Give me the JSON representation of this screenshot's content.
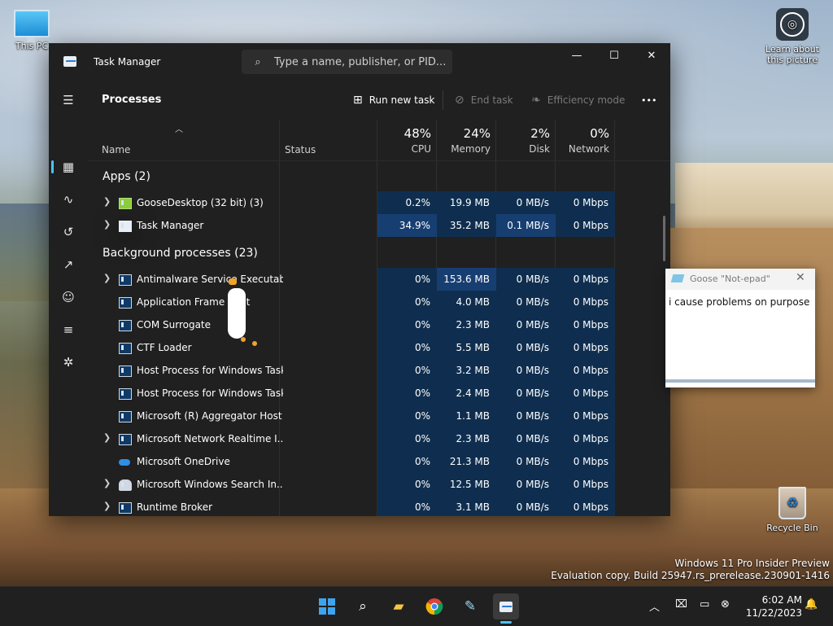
{
  "desktop": {
    "this_pc": "This PC",
    "learn_line1": "Learn about",
    "learn_line2": "this picture",
    "recycle_bin": "Recycle Bin",
    "watermark_line1": "Windows 11 Pro Insider Preview",
    "watermark_line2": "Evaluation copy. Build 25947.rs_prerelease.230901-1416"
  },
  "window": {
    "title": "Task Manager",
    "search_placeholder": "Type a name, publisher, or PID...",
    "minimize": "—",
    "maximize": "☐",
    "close": "✕"
  },
  "toolbar": {
    "page_title": "Processes",
    "run_new_task": "Run new task",
    "end_task": "End task",
    "efficiency_mode": "Efficiency mode",
    "more": "•••"
  },
  "columns": {
    "name": "Name",
    "status": "Status",
    "cpu_pct": "48%",
    "cpu_label": "CPU",
    "mem_pct": "24%",
    "mem_label": "Memory",
    "disk_pct": "2%",
    "disk_label": "Disk",
    "net_pct": "0%",
    "net_label": "Network"
  },
  "groups": {
    "apps": "Apps (2)",
    "background": "Background processes (23)"
  },
  "apps": [
    {
      "name": "GooseDesktop (32 bit) (3)",
      "cpu": "0.2%",
      "mem": "19.9 MB",
      "disk": "0 MB/s",
      "net": "0 Mbps"
    },
    {
      "name": "Task Manager",
      "cpu": "34.9%",
      "mem": "35.2 MB",
      "disk": "0.1 MB/s",
      "net": "0 Mbps"
    }
  ],
  "background": [
    {
      "name": "Antimalware Service Executable",
      "cpu": "0%",
      "mem": "153.6 MB",
      "disk": "0 MB/s",
      "net": "0 Mbps"
    },
    {
      "name": "Application Frame Host",
      "cpu": "0%",
      "mem": "4.0 MB",
      "disk": "0 MB/s",
      "net": "0 Mbps"
    },
    {
      "name": "COM Surrogate",
      "cpu": "0%",
      "mem": "2.3 MB",
      "disk": "0 MB/s",
      "net": "0 Mbps"
    },
    {
      "name": "CTF Loader",
      "cpu": "0%",
      "mem": "5.5 MB",
      "disk": "0 MB/s",
      "net": "0 Mbps"
    },
    {
      "name": "Host Process for Windows Tasks",
      "cpu": "0%",
      "mem": "3.2 MB",
      "disk": "0 MB/s",
      "net": "0 Mbps"
    },
    {
      "name": "Host Process for Windows Tasks",
      "cpu": "0%",
      "mem": "2.4 MB",
      "disk": "0 MB/s",
      "net": "0 Mbps"
    },
    {
      "name": "Microsoft (R) Aggregator Host",
      "cpu": "0%",
      "mem": "1.1 MB",
      "disk": "0 MB/s",
      "net": "0 Mbps"
    },
    {
      "name": "Microsoft Network Realtime I...",
      "cpu": "0%",
      "mem": "2.3 MB",
      "disk": "0 MB/s",
      "net": "0 Mbps"
    },
    {
      "name": "Microsoft OneDrive",
      "cpu": "0%",
      "mem": "21.3 MB",
      "disk": "0 MB/s",
      "net": "0 Mbps"
    },
    {
      "name": "Microsoft Windows Search In...",
      "cpu": "0%",
      "mem": "12.5 MB",
      "disk": "0 MB/s",
      "net": "0 Mbps"
    },
    {
      "name": "Runtime Broker",
      "cpu": "0%",
      "mem": "3.1 MB",
      "disk": "0 MB/s",
      "net": "0 Mbps"
    }
  ],
  "notepad": {
    "title": "Goose \"Not-epad\"",
    "text": "i cause problems on purpose",
    "close": "✕"
  },
  "taskbar": {
    "time": "6:02 AM",
    "date": "11/22/2023"
  },
  "colors": {
    "accent": "#4cc2ff",
    "heat_low": "#0f2e4f",
    "heat_high": "#173e70"
  }
}
